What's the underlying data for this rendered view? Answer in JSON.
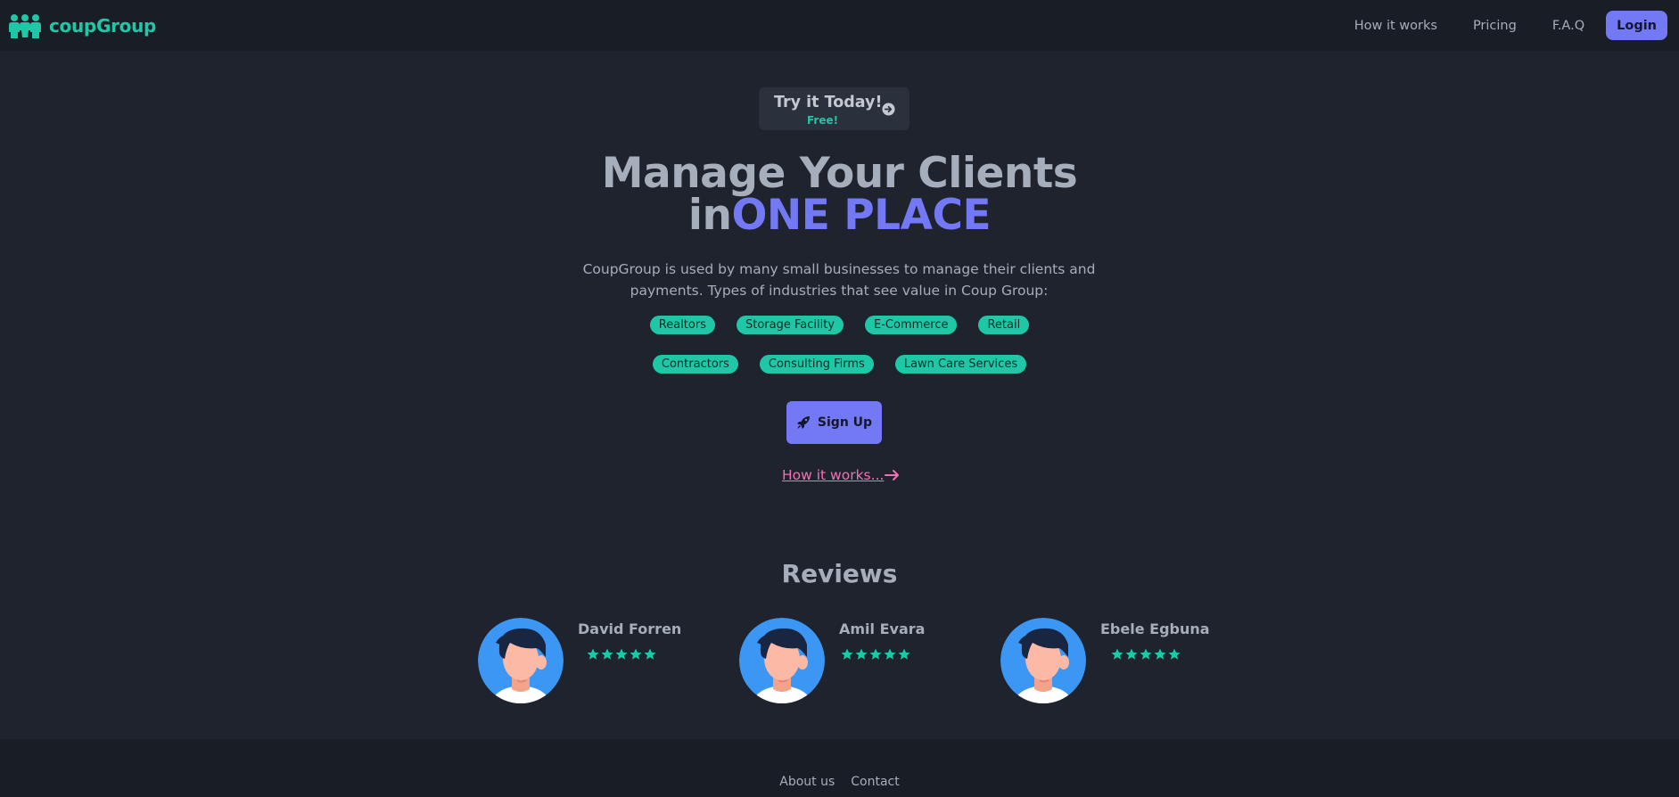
{
  "nav": {
    "brand_name": "coupGroup",
    "brand_icon": "people-group-icon",
    "links": [
      "How it works",
      "Pricing",
      "F.A.Q"
    ],
    "login_label": "Login"
  },
  "hero": {
    "try_main": "Try it Today!",
    "try_sub": "Free!",
    "try_icon": "arrow-circle-right-icon",
    "headline_line1": "Manage Your Clients",
    "headline_in": "in",
    "headline_accent": "ONE PLACE",
    "lead": "CoupGroup is used by many small businesses to manage their clients and payments. Types of industries that see value in Coup Group:",
    "tags_row1": [
      "Realtors",
      "Storage Facility",
      "E-Commerce",
      "Retail"
    ],
    "tags_row2": [
      "Contractors",
      "Consulting Firms",
      "Lawn Care Services"
    ],
    "signup_label": "Sign Up",
    "signup_icon": "rocket-icon",
    "how_link": "How it works...",
    "how_icon": "arrow-right-icon"
  },
  "reviews": {
    "title": "Reviews",
    "items": [
      {
        "name": "David Forren",
        "rating": 5
      },
      {
        "name": "Amil Evara",
        "rating": 5
      },
      {
        "name": "Ebele Egbuna",
        "rating": 5
      }
    ]
  },
  "footer": {
    "links": [
      "About us",
      "Contact"
    ]
  },
  "colors": {
    "background": "#1e232d",
    "navbar": "#191e26",
    "primary": "#7378f5",
    "accent": "#1fc7a7",
    "link_pink": "#f471b5"
  }
}
